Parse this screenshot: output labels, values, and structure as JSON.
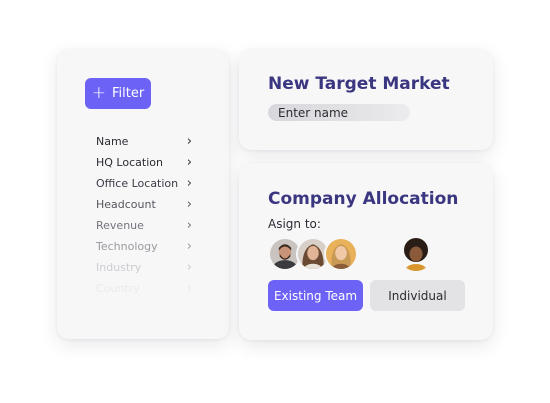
{
  "filter_panel": {
    "button_label": "Filter",
    "button_icon": "plus-icon",
    "accent_color": "#6c63f6",
    "items": [
      {
        "label": "Name",
        "color": "#2b2b33"
      },
      {
        "label": "HQ Location",
        "color": "#2b2b33"
      },
      {
        "label": "Office Location",
        "color": "#3b3b44"
      },
      {
        "label": "Headcount",
        "color": "#56565e"
      },
      {
        "label": "Revenue",
        "color": "#74747c"
      },
      {
        "label": "Technology",
        "color": "#9a9aa1"
      },
      {
        "label": "Industry",
        "color": "#bdbdc3"
      },
      {
        "label": "Country",
        "color": "#dcdce0"
      }
    ],
    "chevron_icon": "chevron-right-icon"
  },
  "target_market": {
    "title": "New Target Market",
    "input_placeholder": "Enter name",
    "input_value": ""
  },
  "company_allocation": {
    "title": "Company Allocation",
    "assign_label": "Asign to:",
    "team_avatars": [
      "avatar-man-beard",
      "avatar-woman-wavy-hair",
      "avatar-woman-blonde"
    ],
    "individual_avatar": "avatar-woman-curly-hair",
    "existing_team_label": "Existing Team",
    "individual_label": "Individual",
    "title_color": "#3b3680"
  }
}
